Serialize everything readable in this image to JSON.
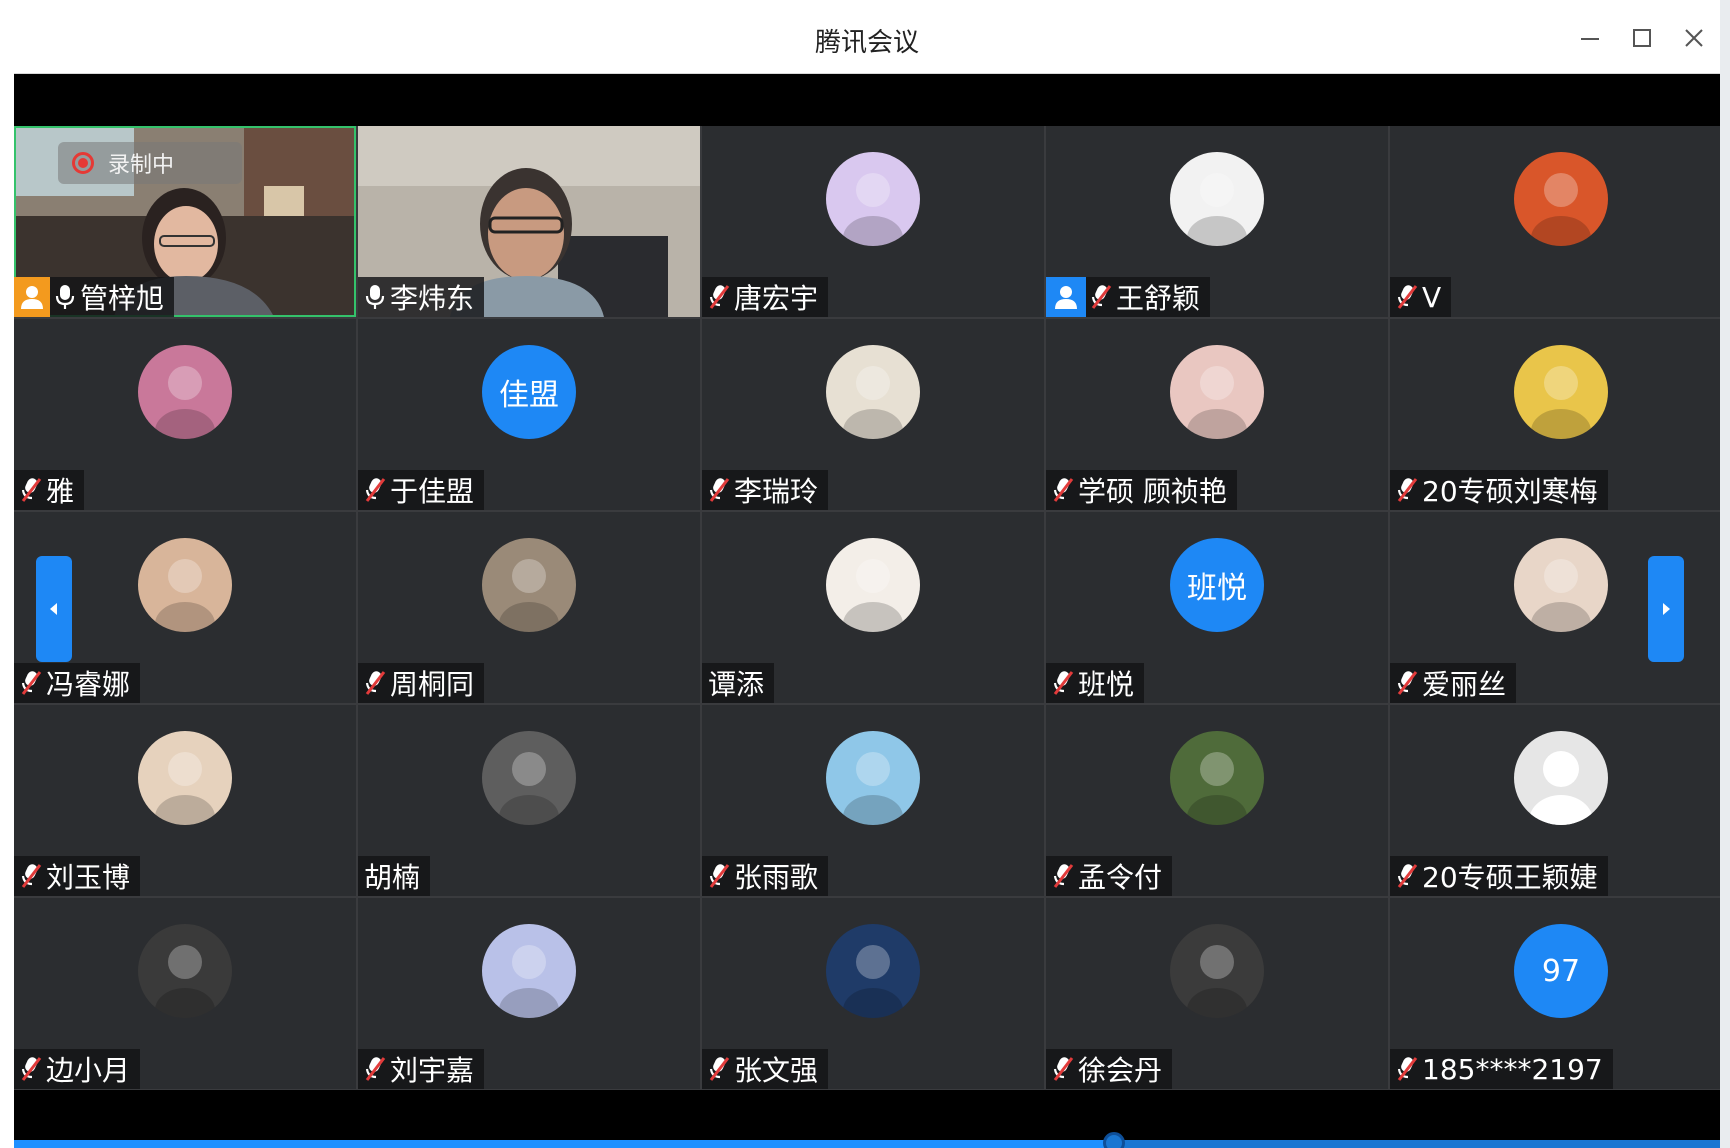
{
  "window": {
    "title": "腾讯会议",
    "minimize_icon": "minimize-icon",
    "maximize_icon": "maximize-icon",
    "close_icon": "close-icon"
  },
  "recording": {
    "label": "录制中",
    "color": "#e53935"
  },
  "colors": {
    "active_border": "#34c26b",
    "avatar_blue": "#1e88f5",
    "host_badge": "#f39a1e",
    "muted_red": "#e23b3b"
  },
  "tiles": [
    {
      "name": "管梓旭",
      "mic": "on",
      "badge": "host",
      "kind": "video",
      "scene": "woman",
      "active": true
    },
    {
      "name": "李炜东",
      "mic": "on",
      "badge": "",
      "kind": "video",
      "scene": "man"
    },
    {
      "name": "唐宏宇",
      "mic": "muted",
      "badge": "",
      "kind": "photo",
      "bg": "#d9c8ef"
    },
    {
      "name": "王舒颖",
      "mic": "muted",
      "badge": "cohost",
      "kind": "photo",
      "bg": "#f2f2f2"
    },
    {
      "name": "V",
      "mic": "muted",
      "badge": "",
      "kind": "photo",
      "bg": "#d9562a"
    },
    {
      "name": "雅",
      "mic": "muted",
      "badge": "",
      "kind": "photo",
      "bg": "#c9789a"
    },
    {
      "name": "于佳盟",
      "mic": "muted",
      "badge": "",
      "kind": "text",
      "avatar_text": "佳盟"
    },
    {
      "name": "李瑞玲",
      "mic": "muted",
      "badge": "",
      "kind": "photo",
      "bg": "#e7e0d3"
    },
    {
      "name": "学硕 顾祯艳",
      "mic": "muted",
      "badge": "",
      "kind": "photo",
      "bg": "#e9c7c1"
    },
    {
      "name": "20专硕刘寒梅",
      "mic": "muted",
      "badge": "",
      "kind": "photo",
      "bg": "#e9c54a"
    },
    {
      "name": "冯睿娜",
      "mic": "muted",
      "badge": "",
      "kind": "photo",
      "bg": "#d8b59a"
    },
    {
      "name": "周桐同",
      "mic": "muted",
      "badge": "",
      "kind": "photo",
      "bg": "#9a8a78"
    },
    {
      "name": "谭添",
      "mic": "none",
      "badge": "",
      "kind": "photo",
      "bg": "#f3eee8"
    },
    {
      "name": "班悦",
      "mic": "muted",
      "badge": "",
      "kind": "text",
      "avatar_text": "班悦"
    },
    {
      "name": "爱丽丝",
      "mic": "muted",
      "badge": "",
      "kind": "photo",
      "bg": "#e8d6c8"
    },
    {
      "name": "刘玉博",
      "mic": "muted",
      "badge": "",
      "kind": "photo",
      "bg": "#e6d2bd"
    },
    {
      "name": "胡楠",
      "mic": "none",
      "badge": "",
      "kind": "photo",
      "bg": "#5e5e5e"
    },
    {
      "name": "张雨歌",
      "mic": "muted",
      "badge": "",
      "kind": "photo",
      "bg": "#8fc7e8"
    },
    {
      "name": "孟令付",
      "mic": "muted",
      "badge": "",
      "kind": "photo",
      "bg": "#4f6b3a"
    },
    {
      "name": "20专硕王颖婕",
      "mic": "muted",
      "badge": "",
      "kind": "placeholder",
      "bg": "#e6e6e6"
    },
    {
      "name": "边小月",
      "mic": "muted",
      "badge": "",
      "kind": "photo",
      "bg": "#3a3a3a"
    },
    {
      "name": "刘宇嘉",
      "mic": "muted",
      "badge": "",
      "kind": "photo",
      "bg": "#b9c1e8"
    },
    {
      "name": "张文强",
      "mic": "muted",
      "badge": "",
      "kind": "photo",
      "bg": "#1f3b68"
    },
    {
      "name": "徐会丹",
      "mic": "muted",
      "badge": "",
      "kind": "photo",
      "bg": "#3b3b3b"
    },
    {
      "name": "185****2197",
      "mic": "muted",
      "badge": "",
      "kind": "text",
      "avatar_text": "97"
    }
  ],
  "pager": {
    "prev_icon": "chevron-left-icon",
    "next_icon": "chevron-right-icon"
  },
  "progress": {
    "fraction": 0.645
  }
}
